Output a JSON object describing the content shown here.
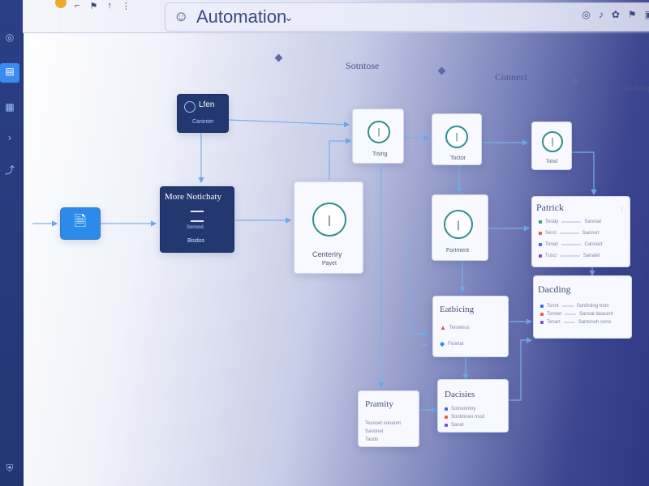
{
  "app": {
    "title": "Automation",
    "title_caret": "⌄",
    "top_icons": [
      "◎",
      "♪",
      "✿",
      "⚑",
      "▣"
    ]
  },
  "sections": [
    {
      "label": "Sotntose"
    },
    {
      "label": "Connect"
    },
    {
      "label": "Nothing"
    }
  ],
  "nodes": {
    "trigger": {
      "title": "Lfen",
      "subtitle": "Caninter"
    },
    "source": {
      "title": "More Notichaty",
      "line1": "Sonood",
      "line2": "Bisdos"
    },
    "main": {
      "title": "Centeriry",
      "subtitle": "Payet"
    },
    "top1": {
      "label": "Tising"
    },
    "top2": {
      "label": "Toctor"
    },
    "top3": {
      "label": "Tohsf"
    },
    "mid": {
      "label": "Fortment"
    },
    "detail": {
      "title": "Patrick",
      "rows": [
        {
          "label": "Teraty",
          "value": "Sarvoat"
        },
        {
          "label": "Sercl",
          "value": "Saonort"
        },
        {
          "label": "Tonan",
          "value": "Caroiact"
        },
        {
          "label": "Tuscr",
          "value": "Sanatet"
        }
      ]
    },
    "deciding": {
      "title": "Dacding",
      "rows": [
        {
          "label": "Tonnt",
          "value": "Sontiniing trom"
        },
        {
          "label": "Tonnet",
          "value": "Sanvat deacent"
        },
        {
          "label": "Tenart",
          "value": "Santonoh sono"
        }
      ]
    },
    "escaping": {
      "title": "Eatbicing",
      "rows": [
        {
          "label": "Tenrehos",
          "icon": "alert"
        },
        {
          "label": "Fioinlat",
          "icon": "info"
        }
      ]
    },
    "priority": {
      "title": "Pramity",
      "rows": [
        {
          "label": "Tesnoet sonannt"
        },
        {
          "label": "Sanonet"
        },
        {
          "label": "Taodo"
        }
      ]
    },
    "decisions": {
      "title": "Dacisies",
      "rows": [
        {
          "label": "Sotnonmtry"
        },
        {
          "label": "Sontmnon rnod"
        },
        {
          "label": "Sanot"
        }
      ]
    }
  },
  "colors": {
    "accent": "#2c8bea",
    "dark_node": "#233870",
    "teal": "#2f8d8f"
  },
  "icons": {
    "sidebar": [
      "globe-icon",
      "layers-icon",
      "grid-icon",
      "chevron-right-icon",
      "share-icon",
      "shield-icon"
    ]
  }
}
